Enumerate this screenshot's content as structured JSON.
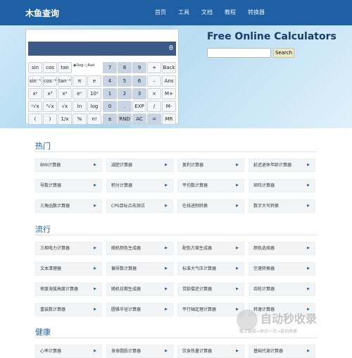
{
  "nav": {
    "brand": "木鱼查询",
    "links": [
      "首页",
      "工具",
      "文档",
      "教程",
      "转换器"
    ]
  },
  "calculator": {
    "display": "0",
    "deg_label": "Deg",
    "rad_label": "Rad",
    "keys": [
      [
        "sin",
        "cos",
        "tan",
        "",
        "7",
        "8",
        "9",
        "+",
        "Back"
      ],
      [
        "sin⁻¹",
        "cos⁻¹",
        "tan⁻¹",
        "π",
        "e",
        "4",
        "5",
        "6",
        "–",
        "Ans"
      ],
      [
        "xʸ",
        "x³",
        "x²",
        "eˣ",
        "10ˣ",
        "1",
        "2",
        "3",
        "×",
        "M+"
      ],
      [
        "ʸ√x",
        "³√x",
        "√x",
        "ln",
        "log",
        "0",
        ".",
        "EXP",
        "/",
        "M-"
      ],
      [
        "(",
        ")",
        "1/x",
        "%",
        "n!",
        "±",
        "RND",
        "AC",
        "=",
        "MR"
      ]
    ]
  },
  "hero": {
    "title": "Free Online Calculators",
    "search_placeholder": "",
    "search_button": "Search"
  },
  "sections": [
    {
      "title": "热门",
      "items": [
        "BMI计算器",
        "减肥计算器",
        "复利计算器",
        "延迟退休年龄计算器",
        "导数计算器",
        "积分计算器",
        "平均数计算器",
        "矩阵计算器",
        "三角函数计算器",
        "CPS鼠标点击测试",
        "在线进制转换",
        "数字大写转换"
      ]
    },
    {
      "title": "流行",
      "items": [
        "三相电力计算器",
        "随机颜色生成器",
        "配色方案生成器",
        "颜色选择器",
        "文本清理器",
        "偏导数计算器",
        "标准大气压计算器",
        "空速转换器",
        "密度海拔高度计算器",
        "随机日期生成器",
        "贷款偿还计算器",
        "齿轮计算器",
        "重装数计算器",
        "圆锥半径计算器",
        "平行轴定理计算器",
        "转速计算器"
      ]
    },
    {
      "title": "健康",
      "items": [
        "心率计算器",
        "身体脂肪计算器",
        "饮食热量计算器",
        "基础代谢计算器"
      ]
    }
  ],
  "watermark": {
    "text": "自动秒收录",
    "sub": "数上链接→来访一次→自动收录"
  }
}
